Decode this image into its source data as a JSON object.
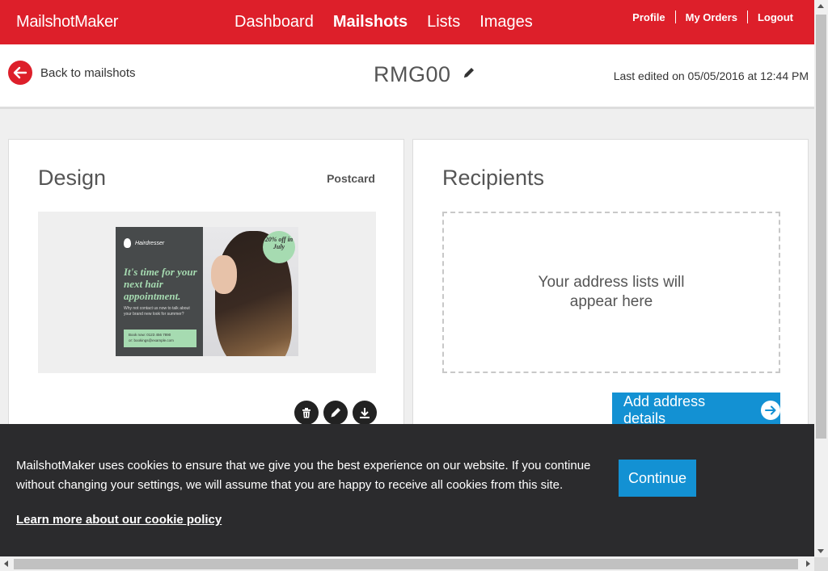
{
  "header": {
    "brand": "MailshotMaker",
    "nav": [
      "Dashboard",
      "Mailshots",
      "Lists",
      "Images"
    ],
    "active_nav": "Mailshots",
    "user_links": [
      "Profile",
      "My Orders",
      "Logout"
    ],
    "accent_color": "#dd1f2a"
  },
  "subheader": {
    "back_label": "Back to mailshots",
    "title": "RMG00",
    "last_edited": "Last edited on 05/05/2016 at 12:44 PM"
  },
  "design": {
    "heading": "Design",
    "type_label": "Postcard",
    "postcard": {
      "brand": "Hairdresser",
      "headline": "It's time for your next hair appointment.",
      "subtext": "Why not contact us now to talk about your brand new look for summer?",
      "book_line1": "Book now: 0123 456 7890",
      "book_line2": "or: bookings@example.com",
      "badge": "20% off in July"
    },
    "actions": [
      "trash-icon",
      "pencil-icon",
      "download-icon"
    ]
  },
  "recipients": {
    "heading": "Recipients",
    "placeholder": "Your address lists will appear here",
    "add_button": "Add address details",
    "button_color": "#1391d3"
  },
  "cookie": {
    "text": "MailshotMaker uses cookies to ensure that we give you the best experience on our website. If you continue without changing your settings, we will assume that you are happy to receive all cookies from this site.",
    "link": "Learn more about our cookie policy",
    "button": "Continue"
  }
}
